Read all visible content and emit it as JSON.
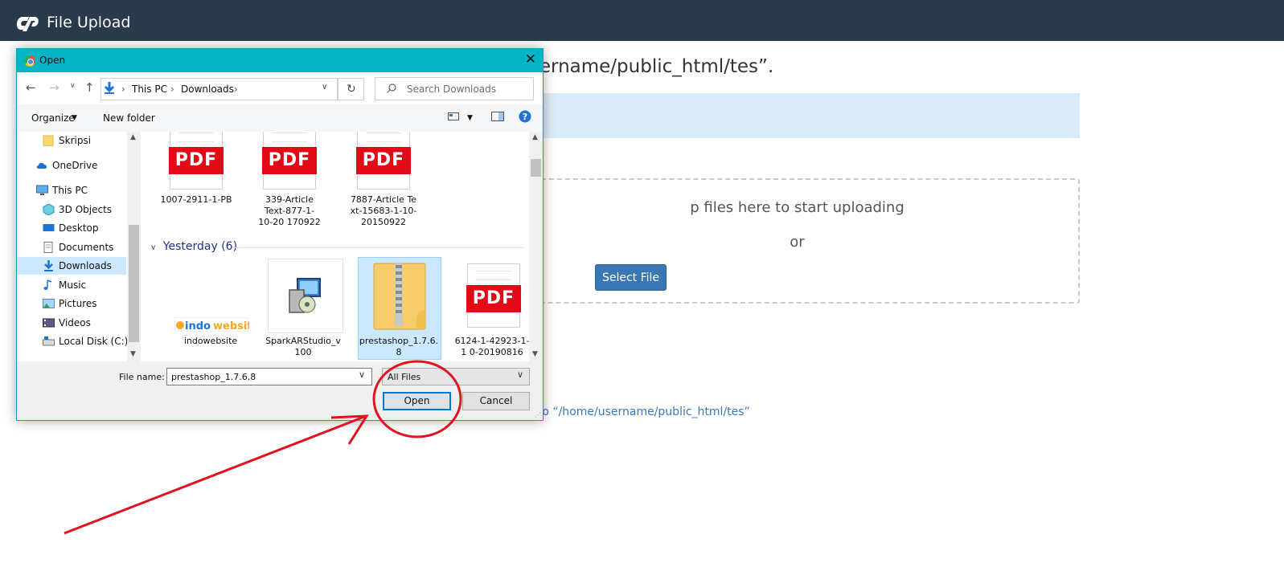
{
  "app": {
    "title": "File Upload"
  },
  "background": {
    "path_text": "me/username/public_html/tes”.",
    "drop_text": "p files here to start uploading",
    "or_text": "or",
    "select_label": "Select File",
    "back_link": "ack to “/home/username/public_html/tes”"
  },
  "dialog": {
    "title": "Open",
    "breadcrumb": [
      "This PC",
      "Downloads"
    ],
    "search_placeholder": "Search Downloads",
    "toolbar": {
      "organize": "Organize",
      "new_folder": "New folder"
    },
    "sidebar": [
      {
        "label": "Skripsi",
        "icon": "folder-icon"
      },
      {
        "label": "OneDrive",
        "icon": "cloud-icon"
      },
      {
        "label": "This PC",
        "icon": "computer-icon"
      },
      {
        "label": "3D Objects",
        "icon": "cube-icon"
      },
      {
        "label": "Desktop",
        "icon": "desktop-icon"
      },
      {
        "label": "Documents",
        "icon": "documents-icon"
      },
      {
        "label": "Downloads",
        "icon": "download-icon",
        "selected": true
      },
      {
        "label": "Music",
        "icon": "music-icon"
      },
      {
        "label": "Pictures",
        "icon": "pictures-icon"
      },
      {
        "label": "Videos",
        "icon": "videos-icon"
      },
      {
        "label": "Local Disk (C:)",
        "icon": "disk-icon"
      }
    ],
    "pdf_badge": "PDF",
    "files_top": [
      {
        "name": "1007-2911-1-PB"
      },
      {
        "name": "339-Article Text-877-1-10-20 170922"
      },
      {
        "name": "7887-Article Text-15683-1-10-20150922"
      }
    ],
    "group": "Yesterday (6)",
    "files_yesterday": [
      {
        "name": "indowebsite",
        "logo": "indowebsite"
      },
      {
        "name": "SparkARStudio_v 100"
      },
      {
        "name": "prestashop_1.7.6. 8",
        "selected": true
      },
      {
        "name": "6124-1-42923-1-1 0-20190816"
      }
    ],
    "filename_label": "File name:",
    "filename_value": "prestashop_1.7.6.8",
    "filetype": "All Files",
    "open_label": "Open",
    "cancel_label": "Cancel"
  },
  "colors": {
    "topbar": "#293a4a",
    "titlebar": "#04b6c5",
    "annotation": "#e0141e",
    "button": "#3a78b5",
    "info": "#d9ecf8"
  }
}
